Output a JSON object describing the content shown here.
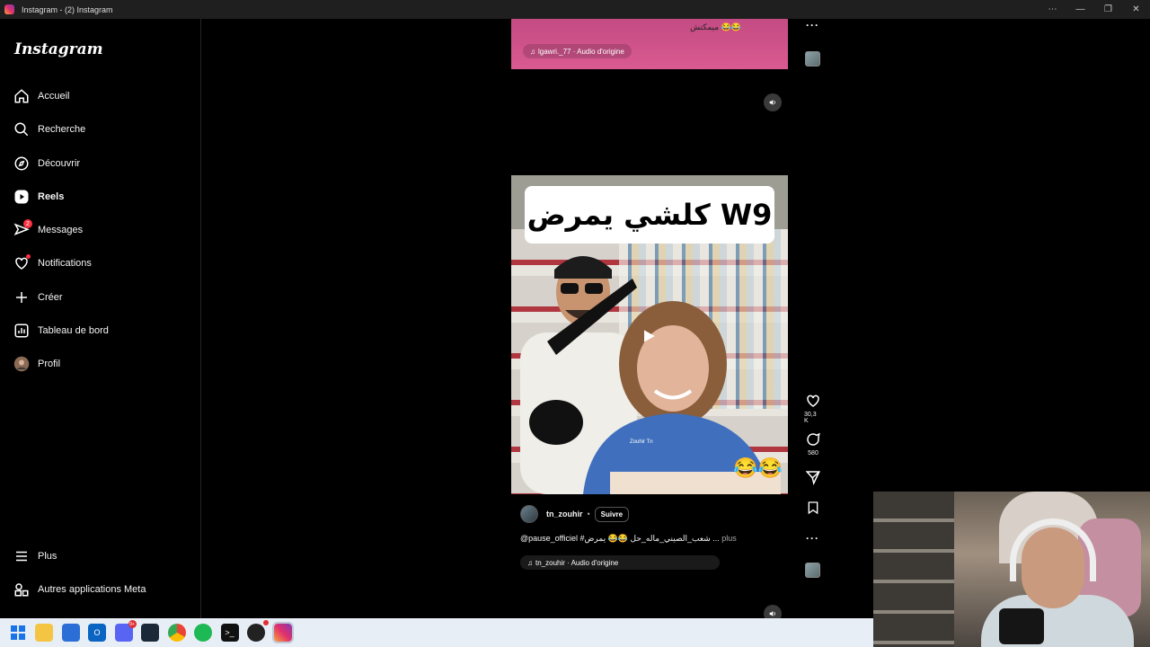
{
  "window": {
    "title": "Instagram - (2) Instagram"
  },
  "sidebar": {
    "logo": "Instagram",
    "items": [
      {
        "label": "Accueil",
        "icon": "home-icon"
      },
      {
        "label": "Recherche",
        "icon": "search-icon"
      },
      {
        "label": "Découvrir",
        "icon": "compass-icon"
      },
      {
        "label": "Reels",
        "icon": "reels-icon",
        "active": true
      },
      {
        "label": "Messages",
        "icon": "messenger-icon",
        "badge": "2"
      },
      {
        "label": "Notifications",
        "icon": "heart-icon"
      },
      {
        "label": "Créer",
        "icon": "plus-icon"
      },
      {
        "label": "Tableau de bord",
        "icon": "dashboard-icon"
      },
      {
        "label": "Profil",
        "icon": "avatar-icon"
      }
    ],
    "bottom": [
      {
        "label": "Plus",
        "icon": "menu-icon"
      },
      {
        "label": "Autres applications Meta",
        "icon": "meta-apps-icon"
      }
    ]
  },
  "previous_reel": {
    "caption": "ميمكتش 😂😂",
    "audio": "lgawri._77 · Audio d'origine"
  },
  "reel": {
    "video_text": "كلشي يمرض W9",
    "watermark": "Zouhir Tn",
    "emojis": "😂😂",
    "likes": "30,3 K",
    "comments": "580",
    "author": "tn_zouhir",
    "separator": "•",
    "follow": "Suivre",
    "description": "@pause_officiel #شعب_الصيني_ماله_حل 😂😂 يمرض ...",
    "more_label": " plus",
    "audio": "tn_zouhir · Audio d'origine"
  },
  "taskbar": {
    "discord_badge": "9+",
    "icons": [
      "windows-start-icon",
      "file-explorer-icon",
      "store-icon",
      "outlook-icon",
      "discord-icon",
      "steam-icon",
      "chrome-icon",
      "spotify-icon",
      "terminal-icon",
      "github-icon",
      "instagram-icon"
    ]
  },
  "colors": {
    "background": "#000000",
    "badge": "#ff3040",
    "previous_reel": "#d95a90",
    "taskbar": "#e8eef6"
  }
}
